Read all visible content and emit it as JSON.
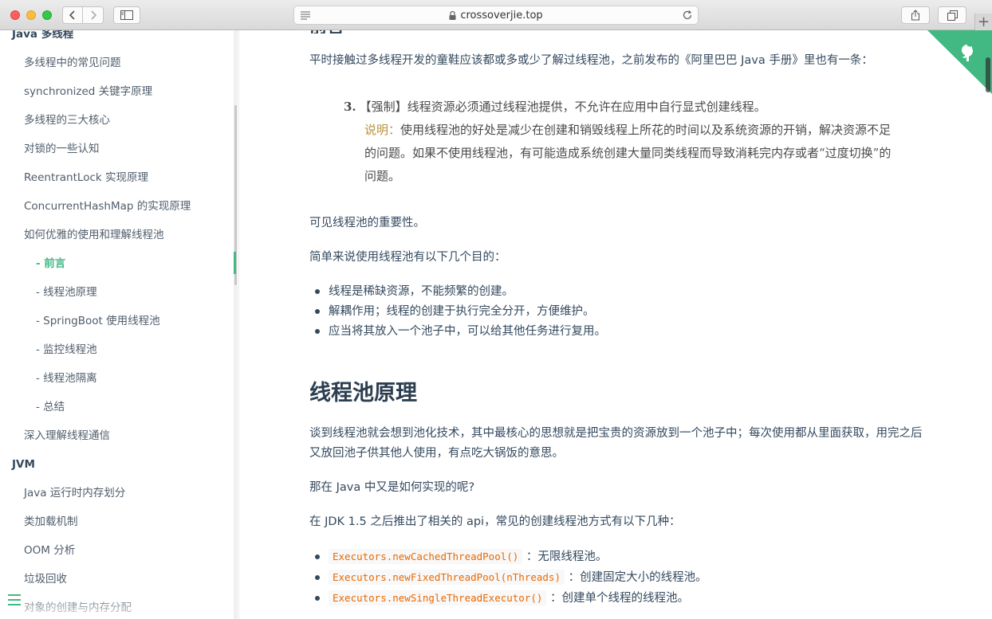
{
  "browser": {
    "url": "crossoverjie.top"
  },
  "sidebar": {
    "items": [
      {
        "label": "Java 多线程",
        "kind": "section"
      },
      {
        "label": "多线程中的常见问题",
        "kind": "item"
      },
      {
        "label": "synchronized 关键字原理",
        "kind": "item"
      },
      {
        "label": "多线程的三大核心",
        "kind": "item"
      },
      {
        "label": "对锁的一些认知",
        "kind": "item"
      },
      {
        "label": "ReentrantLock 实现原理",
        "kind": "item"
      },
      {
        "label": "ConcurrentHashMap 的实现原理",
        "kind": "item"
      },
      {
        "label": "如何优雅的使用和理解线程池",
        "kind": "item"
      },
      {
        "label": "- 前言",
        "kind": "sub-active"
      },
      {
        "label": "- 线程池原理",
        "kind": "sub"
      },
      {
        "label": "- SpringBoot 使用线程池",
        "kind": "sub"
      },
      {
        "label": "- 监控线程池",
        "kind": "sub"
      },
      {
        "label": "- 线程池隔离",
        "kind": "sub"
      },
      {
        "label": "- 总结",
        "kind": "sub"
      },
      {
        "label": "深入理解线程通信",
        "kind": "item"
      },
      {
        "label": "JVM",
        "kind": "section"
      },
      {
        "label": "Java 运行时内存划分",
        "kind": "item"
      },
      {
        "label": "类加载机制",
        "kind": "item"
      },
      {
        "label": "OOM 分析",
        "kind": "item"
      },
      {
        "label": "垃圾回收",
        "kind": "item"
      },
      {
        "label": "对象的创建与内存分配",
        "kind": "item"
      }
    ]
  },
  "content": {
    "prev_heading": "前言",
    "intro": "平时接触过多线程开发的童鞋应该都或多或少了解过线程池，之前发布的《阿里巴巴 Java 手册》里也有一条：",
    "quote_number": "3.",
    "quote_rule": "【强制】线程资源必须通过线程池提供，不允许在应用中自行显式创建线程。",
    "quote_note_label": "说明：",
    "quote_note": "使用线程池的好处是减少在创建和销毁线程上所花的时间以及系统资源的开销，解决资源不足的问题。如果不使用线程池，有可能造成系统创建大量同类线程而导致消耗完内存或者“过度切换”的问题。",
    "importance": "可见线程池的重要性。",
    "purposes_intro": "简单来说使用线程池有以下几个目的：",
    "purposes": [
      "线程是稀缺资源，不能频繁的创建。",
      "解耦作用；线程的创建于执行完全分开，方便维护。",
      "应当将其放入一个池子中，可以给其他任务进行复用。"
    ],
    "section_title": "线程池原理",
    "principle": "谈到线程池就会想到池化技术，其中最核心的思想就是把宝贵的资源放到一个池子中；每次使用都从里面获取，用完之后又放回池子供其他人使用，有点吃大锅饭的意思。",
    "java_q": "那在 Java 中又是如何实现的呢?",
    "jdk_intro": "在 JDK 1.5 之后推出了相关的 api，常见的创建线程池方式有以下几种：",
    "pools": [
      {
        "code": "Executors.newCachedThreadPool()",
        "desc": "：无限线程池。"
      },
      {
        "code": "Executors.newFixedThreadPool(nThreads)",
        "desc": "：创建固定大小的线程池。"
      },
      {
        "code": "Executors.newSingleThreadExecutor()",
        "desc": "：创建单个线程的线程池。"
      }
    ]
  },
  "colors": {
    "accent": "#42b983",
    "text": "#34495e",
    "code": "#e96900",
    "note": "#b8913b"
  }
}
